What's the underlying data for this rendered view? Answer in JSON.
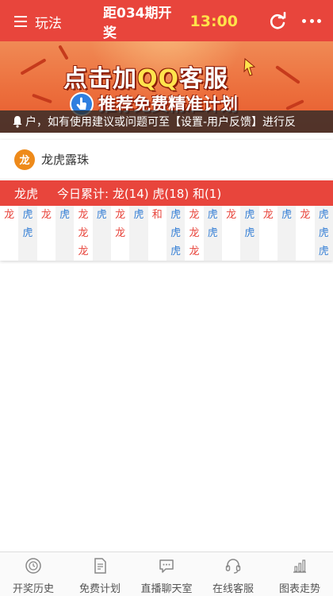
{
  "header": {
    "menu_label": "玩法",
    "period_text": "距034期开奖",
    "countdown": "13:00",
    "icons": [
      "menu-icon",
      "refresh-icon",
      "more-icon"
    ]
  },
  "banner": {
    "line1_prefix": "点击加",
    "line1_qq": "QQ",
    "line1_suffix": "客服",
    "line2": "推荐免费精准计划"
  },
  "notice": {
    "text": "户，如有使用建议或问题可至【设置-用户反馈】进行反",
    "icon": "bell-icon"
  },
  "card": {
    "badge": "龙",
    "title": "龙虎露珠",
    "stats_label": "龙虎",
    "stats_text": "今日累计: 龙(14) 虎(18) 和(1)",
    "columns": [
      [
        "龙"
      ],
      [
        "虎",
        "虎"
      ],
      [
        "龙"
      ],
      [
        "虎"
      ],
      [
        "龙",
        "龙",
        "龙"
      ],
      [
        "虎"
      ],
      [
        "龙",
        "龙"
      ],
      [
        "虎"
      ],
      [
        "和"
      ],
      [
        "虎",
        "虎",
        "虎"
      ],
      [
        "龙",
        "龙",
        "龙"
      ],
      [
        "虎",
        "虎"
      ],
      [
        "龙"
      ],
      [
        "虎",
        "虎"
      ],
      [
        "龙"
      ],
      [
        "虎"
      ],
      [
        "龙"
      ],
      [
        "虎",
        "虎",
        "虎"
      ]
    ]
  },
  "bottom_nav": [
    {
      "label": "开奖历史",
      "icon": "history-icon"
    },
    {
      "label": "免费计划",
      "icon": "document-icon"
    },
    {
      "label": "直播聊天室",
      "icon": "chat-icon"
    },
    {
      "label": "在线客服",
      "icon": "headset-icon"
    },
    {
      "label": "图表走势",
      "icon": "chart-icon"
    }
  ],
  "colors": {
    "primary": "#e8453c",
    "countdown": "#ffe24a",
    "dragon": "#e8453c",
    "tiger": "#3a82d6",
    "badge": "#ee8a1a"
  }
}
